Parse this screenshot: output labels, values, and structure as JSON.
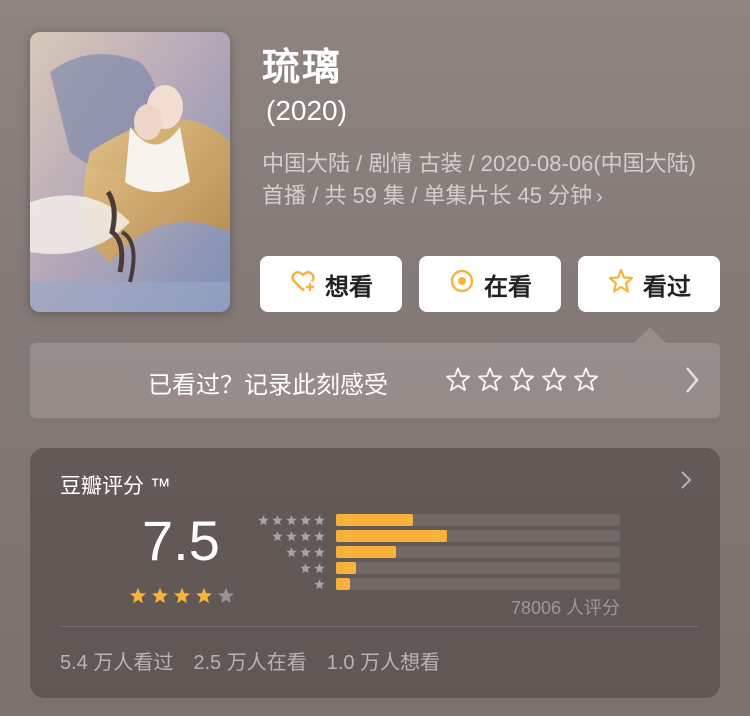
{
  "title": "琉璃",
  "year": "(2020)",
  "meta": "中国大陆 / 剧情 古装 / 2020-08-06(中国大陆) 首播 / 共 59 集 / 单集片长 45 分钟",
  "actions": {
    "want_label": "想看",
    "watching_label": "在看",
    "watched_label": "看过"
  },
  "record": {
    "text": "已看过？记录此刻感受",
    "star_count": 5
  },
  "rating": {
    "title": "豆瓣评分 ™",
    "score": "7.5",
    "score_stars": 3.8,
    "count_label": "78006 人评分",
    "distribution": [
      {
        "stars": 5,
        "fraction": 0.27
      },
      {
        "stars": 4,
        "fraction": 0.39
      },
      {
        "stars": 3,
        "fraction": 0.21
      },
      {
        "stars": 2,
        "fraction": 0.07
      },
      {
        "stars": 1,
        "fraction": 0.05
      }
    ],
    "stats": {
      "watched": "5.4 万人看过",
      "watching": "2.5 万人在看",
      "want": "1.0 万人想看"
    }
  },
  "colors": {
    "accent_orange": "#f8b23b",
    "bar_fill": "#f8b23b"
  },
  "icons": {
    "want": "heart-plus-icon",
    "watching": "target-circle-icon",
    "watched": "star-outline-icon"
  }
}
